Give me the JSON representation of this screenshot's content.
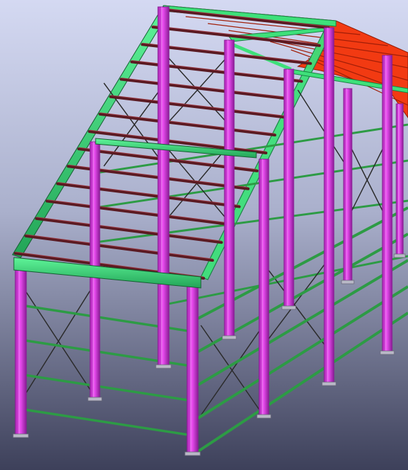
{
  "viewport": {
    "background_top": "#d4d9f2",
    "background_bottom": "#3d405a"
  },
  "colors": {
    "column_magenta": "#e23ce8",
    "column_shadow": "#8a1c96",
    "rafter_green": "#3ee07a",
    "rafter_shadow": "#178042",
    "purlin_dark": "#5a1a22",
    "roof_red": "#f23a12",
    "girt_green": "#2d9b45",
    "bracing": "#2b2b2b",
    "baseplate": "#b9b9c7"
  }
}
